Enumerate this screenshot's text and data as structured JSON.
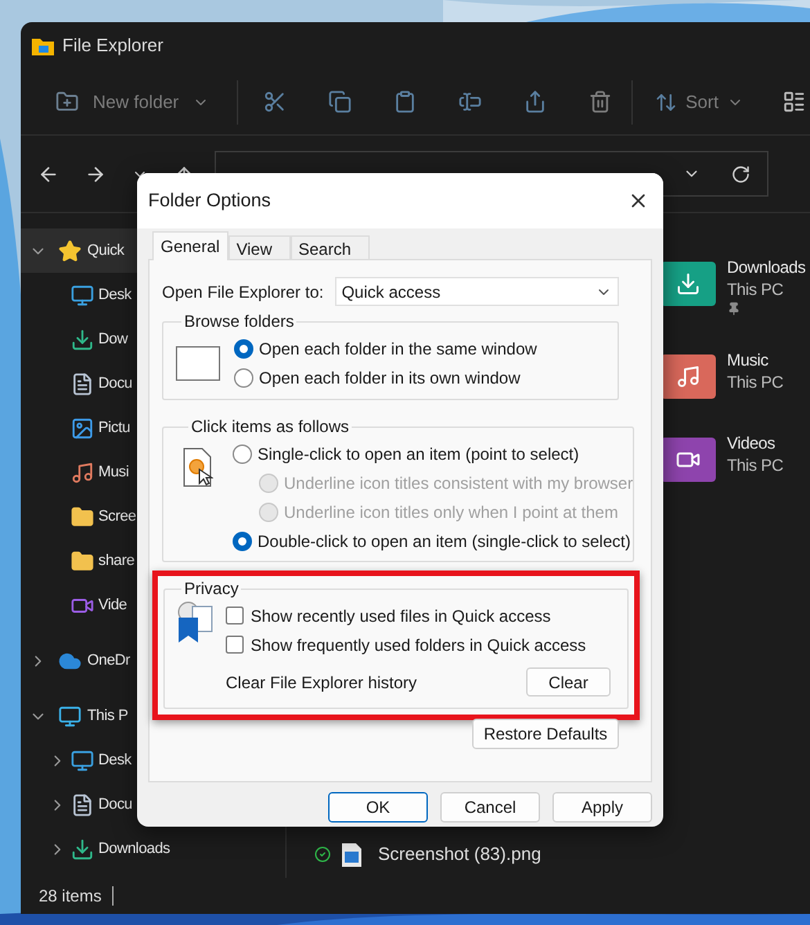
{
  "explorer": {
    "title": "File Explorer",
    "toolbar": {
      "new_folder": "New folder",
      "sort": "Sort"
    },
    "sidebar": [
      {
        "label": "Quick",
        "kind": "star",
        "expanded": true,
        "selected": true,
        "children": [
          {
            "label": "Desk",
            "kind": "desktop",
            "selected": false
          },
          {
            "label": "Dow",
            "kind": "download",
            "selected": false
          },
          {
            "label": "Docu",
            "kind": "document",
            "selected": false
          },
          {
            "label": "Pictu",
            "kind": "pictures",
            "selected": false
          },
          {
            "label": "Musi",
            "kind": "music",
            "selected": false
          },
          {
            "label": "Scree",
            "kind": "shortcut-folder",
            "selected": false
          },
          {
            "label": "share",
            "kind": "folder",
            "selected": false
          },
          {
            "label": "Vide",
            "kind": "video",
            "selected": false
          }
        ]
      },
      {
        "label": "OneDr",
        "kind": "cloud",
        "expanded": false,
        "selected": false
      },
      {
        "label": "This P",
        "kind": "pc",
        "expanded": true,
        "selected": false,
        "children": [
          {
            "label": "Desk",
            "kind": "desktop",
            "selected": false,
            "expanded": false
          },
          {
            "label": "Docu",
            "kind": "document",
            "selected": false,
            "expanded": false
          },
          {
            "label": "Downloads",
            "kind": "download",
            "selected": false,
            "expanded": false
          }
        ]
      }
    ],
    "tiles": [
      {
        "name": "Downloads",
        "location": "This PC",
        "kind": "downloads",
        "pinned": true
      },
      {
        "name": "Music",
        "location": "This PC",
        "kind": "music",
        "pinned": false
      },
      {
        "name": "Videos",
        "location": "This PC",
        "kind": "videos",
        "pinned": false
      }
    ],
    "files": [
      {
        "name": "Screenshot (83).png",
        "synced": true
      }
    ],
    "status_bar": {
      "items": "28 items"
    }
  },
  "dialog": {
    "title": "Folder Options",
    "tabs": [
      {
        "label": "General",
        "selected": true
      },
      {
        "label": "View",
        "selected": false
      },
      {
        "label": "Search",
        "selected": false
      }
    ],
    "open_to": {
      "label": "Open File Explorer to:",
      "value": "Quick access"
    },
    "browse_folders": {
      "title": "Browse folders",
      "options": [
        {
          "label": "Open each folder in the same window",
          "selected": true
        },
        {
          "label": "Open each folder in its own window",
          "selected": false
        }
      ]
    },
    "click_items": {
      "title": "Click items as follows",
      "options": [
        {
          "label": "Single-click to open an item (point to select)",
          "selected": false,
          "disabled": false,
          "children": [
            {
              "label": "Underline icon titles consistent with my browser",
              "selected": false,
              "disabled": true
            },
            {
              "label": "Underline icon titles only when I point at them",
              "selected": false,
              "disabled": true
            }
          ]
        },
        {
          "label": "Double-click to open an item (single-click to select)",
          "selected": true,
          "disabled": false
        }
      ]
    },
    "privacy": {
      "title": "Privacy",
      "highlighted": true,
      "options": [
        {
          "label": "Show recently used files in Quick access",
          "checked": false
        },
        {
          "label": "Show frequently used folders in Quick access",
          "checked": false
        }
      ],
      "clear_label": "Clear File Explorer history",
      "clear_button": "Clear"
    },
    "restore_button": "Restore Defaults",
    "buttons": [
      {
        "label": "OK",
        "default": true
      },
      {
        "label": "Cancel",
        "default": false
      },
      {
        "label": "Apply",
        "default": false
      }
    ]
  }
}
